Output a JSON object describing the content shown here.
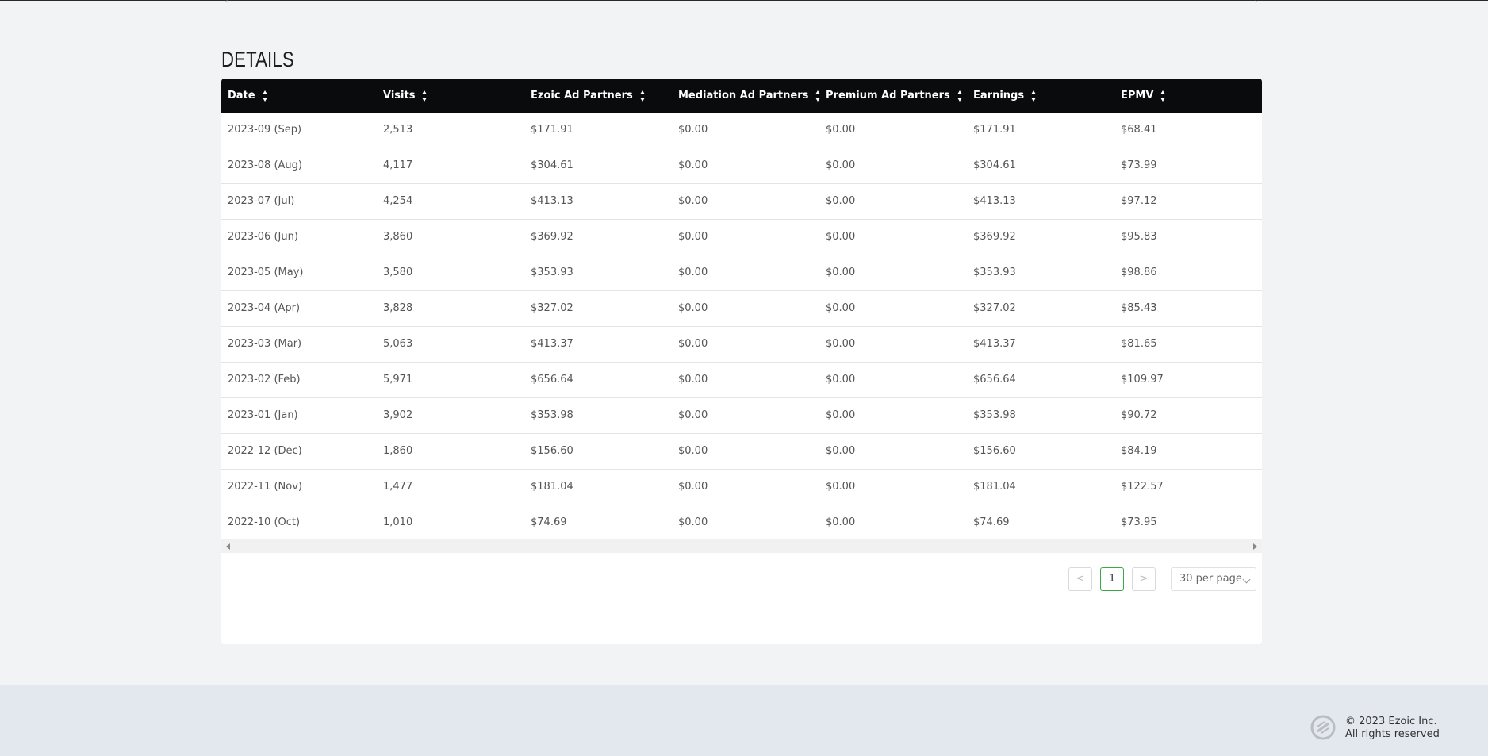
{
  "section": {
    "title": "DETAILS"
  },
  "table": {
    "columns": [
      {
        "label": "Date"
      },
      {
        "label": "Visits"
      },
      {
        "label": "Ezoic Ad Partners"
      },
      {
        "label": "Mediation Ad Partners"
      },
      {
        "label": "Premium Ad Partners"
      },
      {
        "label": "Earnings"
      },
      {
        "label": "EPMV"
      }
    ],
    "rows": [
      [
        "2023-09 (Sep)",
        "2,513",
        "$171.91",
        "$0.00",
        "$0.00",
        "$171.91",
        "$68.41"
      ],
      [
        "2023-08 (Aug)",
        "4,117",
        "$304.61",
        "$0.00",
        "$0.00",
        "$304.61",
        "$73.99"
      ],
      [
        "2023-07 (Jul)",
        "4,254",
        "$413.13",
        "$0.00",
        "$0.00",
        "$413.13",
        "$97.12"
      ],
      [
        "2023-06 (Jun)",
        "3,860",
        "$369.92",
        "$0.00",
        "$0.00",
        "$369.92",
        "$95.83"
      ],
      [
        "2023-05 (May)",
        "3,580",
        "$353.93",
        "$0.00",
        "$0.00",
        "$353.93",
        "$98.86"
      ],
      [
        "2023-04 (Apr)",
        "3,828",
        "$327.02",
        "$0.00",
        "$0.00",
        "$327.02",
        "$85.43"
      ],
      [
        "2023-03 (Mar)",
        "5,063",
        "$413.37",
        "$0.00",
        "$0.00",
        "$413.37",
        "$81.65"
      ],
      [
        "2023-02 (Feb)",
        "5,971",
        "$656.64",
        "$0.00",
        "$0.00",
        "$656.64",
        "$109.97"
      ],
      [
        "2023-01 (Jan)",
        "3,902",
        "$353.98",
        "$0.00",
        "$0.00",
        "$353.98",
        "$90.72"
      ],
      [
        "2022-12 (Dec)",
        "1,860",
        "$156.60",
        "$0.00",
        "$0.00",
        "$156.60",
        "$84.19"
      ],
      [
        "2022-11 (Nov)",
        "1,477",
        "$181.04",
        "$0.00",
        "$0.00",
        "$181.04",
        "$122.57"
      ],
      [
        "2022-10 (Oct)",
        "1,010",
        "$74.69",
        "$0.00",
        "$0.00",
        "$74.69",
        "$73.95"
      ]
    ]
  },
  "pagination": {
    "prev": "<",
    "current_page": "1",
    "next": ">",
    "per_page": "30 per page"
  },
  "footer": {
    "copyright": "© 2023 Ezoic Inc.",
    "rights": "All rights reserved"
  },
  "colors": {
    "header_bg": "#0a0b0d",
    "active_page_border": "#3aa844",
    "page_bg": "#f2f3f5",
    "footer_bg": "#e3e7ee"
  }
}
